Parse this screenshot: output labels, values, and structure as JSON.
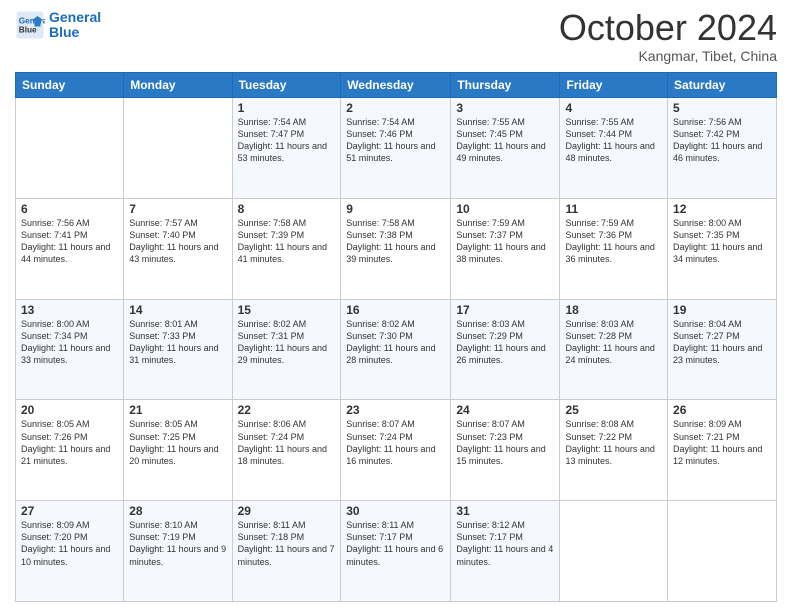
{
  "header": {
    "logo_line1": "General",
    "logo_line2": "Blue",
    "month": "October 2024",
    "location": "Kangmar, Tibet, China"
  },
  "weekdays": [
    "Sunday",
    "Monday",
    "Tuesday",
    "Wednesday",
    "Thursday",
    "Friday",
    "Saturday"
  ],
  "weeks": [
    [
      {
        "day": "",
        "info": ""
      },
      {
        "day": "",
        "info": ""
      },
      {
        "day": "1",
        "info": "Sunrise: 7:54 AM\nSunset: 7:47 PM\nDaylight: 11 hours and 53 minutes."
      },
      {
        "day": "2",
        "info": "Sunrise: 7:54 AM\nSunset: 7:46 PM\nDaylight: 11 hours and 51 minutes."
      },
      {
        "day": "3",
        "info": "Sunrise: 7:55 AM\nSunset: 7:45 PM\nDaylight: 11 hours and 49 minutes."
      },
      {
        "day": "4",
        "info": "Sunrise: 7:55 AM\nSunset: 7:44 PM\nDaylight: 11 hours and 48 minutes."
      },
      {
        "day": "5",
        "info": "Sunrise: 7:56 AM\nSunset: 7:42 PM\nDaylight: 11 hours and 46 minutes."
      }
    ],
    [
      {
        "day": "6",
        "info": "Sunrise: 7:56 AM\nSunset: 7:41 PM\nDaylight: 11 hours and 44 minutes."
      },
      {
        "day": "7",
        "info": "Sunrise: 7:57 AM\nSunset: 7:40 PM\nDaylight: 11 hours and 43 minutes."
      },
      {
        "day": "8",
        "info": "Sunrise: 7:58 AM\nSunset: 7:39 PM\nDaylight: 11 hours and 41 minutes."
      },
      {
        "day": "9",
        "info": "Sunrise: 7:58 AM\nSunset: 7:38 PM\nDaylight: 11 hours and 39 minutes."
      },
      {
        "day": "10",
        "info": "Sunrise: 7:59 AM\nSunset: 7:37 PM\nDaylight: 11 hours and 38 minutes."
      },
      {
        "day": "11",
        "info": "Sunrise: 7:59 AM\nSunset: 7:36 PM\nDaylight: 11 hours and 36 minutes."
      },
      {
        "day": "12",
        "info": "Sunrise: 8:00 AM\nSunset: 7:35 PM\nDaylight: 11 hours and 34 minutes."
      }
    ],
    [
      {
        "day": "13",
        "info": "Sunrise: 8:00 AM\nSunset: 7:34 PM\nDaylight: 11 hours and 33 minutes."
      },
      {
        "day": "14",
        "info": "Sunrise: 8:01 AM\nSunset: 7:33 PM\nDaylight: 11 hours and 31 minutes."
      },
      {
        "day": "15",
        "info": "Sunrise: 8:02 AM\nSunset: 7:31 PM\nDaylight: 11 hours and 29 minutes."
      },
      {
        "day": "16",
        "info": "Sunrise: 8:02 AM\nSunset: 7:30 PM\nDaylight: 11 hours and 28 minutes."
      },
      {
        "day": "17",
        "info": "Sunrise: 8:03 AM\nSunset: 7:29 PM\nDaylight: 11 hours and 26 minutes."
      },
      {
        "day": "18",
        "info": "Sunrise: 8:03 AM\nSunset: 7:28 PM\nDaylight: 11 hours and 24 minutes."
      },
      {
        "day": "19",
        "info": "Sunrise: 8:04 AM\nSunset: 7:27 PM\nDaylight: 11 hours and 23 minutes."
      }
    ],
    [
      {
        "day": "20",
        "info": "Sunrise: 8:05 AM\nSunset: 7:26 PM\nDaylight: 11 hours and 21 minutes."
      },
      {
        "day": "21",
        "info": "Sunrise: 8:05 AM\nSunset: 7:25 PM\nDaylight: 11 hours and 20 minutes."
      },
      {
        "day": "22",
        "info": "Sunrise: 8:06 AM\nSunset: 7:24 PM\nDaylight: 11 hours and 18 minutes."
      },
      {
        "day": "23",
        "info": "Sunrise: 8:07 AM\nSunset: 7:24 PM\nDaylight: 11 hours and 16 minutes."
      },
      {
        "day": "24",
        "info": "Sunrise: 8:07 AM\nSunset: 7:23 PM\nDaylight: 11 hours and 15 minutes."
      },
      {
        "day": "25",
        "info": "Sunrise: 8:08 AM\nSunset: 7:22 PM\nDaylight: 11 hours and 13 minutes."
      },
      {
        "day": "26",
        "info": "Sunrise: 8:09 AM\nSunset: 7:21 PM\nDaylight: 11 hours and 12 minutes."
      }
    ],
    [
      {
        "day": "27",
        "info": "Sunrise: 8:09 AM\nSunset: 7:20 PM\nDaylight: 11 hours and 10 minutes."
      },
      {
        "day": "28",
        "info": "Sunrise: 8:10 AM\nSunset: 7:19 PM\nDaylight: 11 hours and 9 minutes."
      },
      {
        "day": "29",
        "info": "Sunrise: 8:11 AM\nSunset: 7:18 PM\nDaylight: 11 hours and 7 minutes."
      },
      {
        "day": "30",
        "info": "Sunrise: 8:11 AM\nSunset: 7:17 PM\nDaylight: 11 hours and 6 minutes."
      },
      {
        "day": "31",
        "info": "Sunrise: 8:12 AM\nSunset: 7:17 PM\nDaylight: 11 hours and 4 minutes."
      },
      {
        "day": "",
        "info": ""
      },
      {
        "day": "",
        "info": ""
      }
    ]
  ]
}
